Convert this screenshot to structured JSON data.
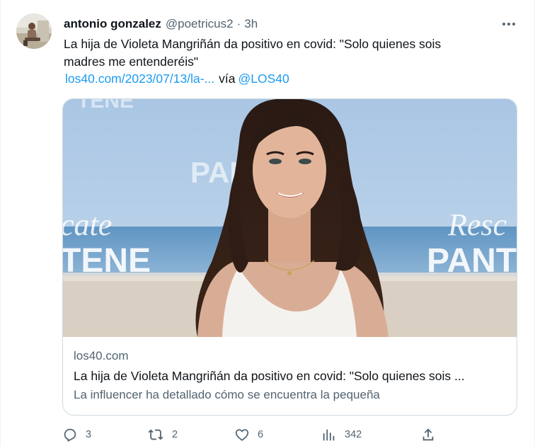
{
  "tweet": {
    "author_name": "antonio gonzalez",
    "author_handle": "@poetricus2",
    "separator": "·",
    "timestamp": "3h",
    "text_line1": "La hija de Violeta Mangriñán da positivo en covid: \"Solo quienes sois",
    "text_line2": "madres me entenderéis\"",
    "link_text": "los40.com/2023/07/13/la-...",
    "via_text": "vía",
    "mention": "@LOS40"
  },
  "card": {
    "domain": "los40.com",
    "title": "La hija de Violeta Mangriñán da positivo en covid: \"Solo quienes sois ...",
    "description": "La influencer ha detallado cómo se encuentra la pequeña",
    "image_backdrop_text_left_1": "cate",
    "image_backdrop_text_left_2": "TENE",
    "image_backdrop_text_center": "PANTE",
    "image_backdrop_text_right_1": "Resc",
    "image_backdrop_text_right_2": "PANT",
    "image_backdrop_text_top": "TENE"
  },
  "actions": {
    "reply_icon": "reply-icon",
    "reply_count": "3",
    "retweet_icon": "retweet-icon",
    "retweet_count": "2",
    "like_icon": "heart-icon",
    "like_count": "6",
    "views_icon": "views-icon",
    "views_count": "342",
    "share_icon": "share-icon"
  },
  "colors": {
    "accent": "#1d9bf0",
    "secondary_text": "#536471",
    "primary_text": "#0f1419",
    "border": "#cfd9de"
  }
}
